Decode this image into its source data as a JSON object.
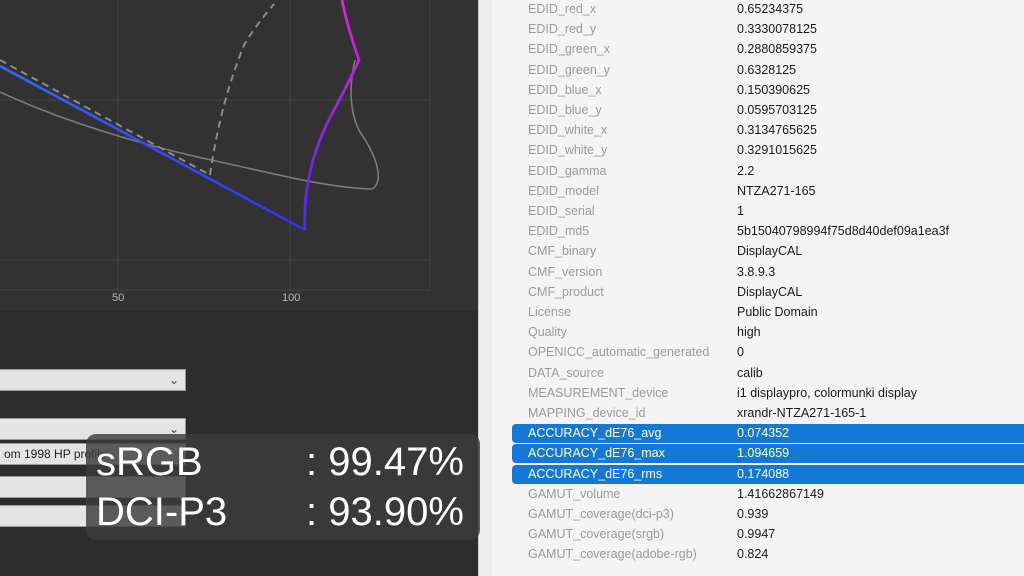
{
  "plot": {
    "x_ticks": [
      "50",
      "100"
    ]
  },
  "controls": {
    "combo_1": "",
    "combo_2": "",
    "combo_3": "om 1998 HP profile"
  },
  "properties": [
    {
      "key": "EDID_red_x",
      "value": "0.65234375",
      "selected": false
    },
    {
      "key": "EDID_red_y",
      "value": "0.3330078125",
      "selected": false
    },
    {
      "key": "EDID_green_x",
      "value": "0.2880859375",
      "selected": false
    },
    {
      "key": "EDID_green_y",
      "value": "0.6328125",
      "selected": false
    },
    {
      "key": "EDID_blue_x",
      "value": "0.150390625",
      "selected": false
    },
    {
      "key": "EDID_blue_y",
      "value": "0.0595703125",
      "selected": false
    },
    {
      "key": "EDID_white_x",
      "value": "0.3134765625",
      "selected": false
    },
    {
      "key": "EDID_white_y",
      "value": "0.3291015625",
      "selected": false
    },
    {
      "key": "EDID_gamma",
      "value": "2.2",
      "selected": false
    },
    {
      "key": "EDID_model",
      "value": "NTZA271-165",
      "selected": false
    },
    {
      "key": "EDID_serial",
      "value": "1",
      "selected": false
    },
    {
      "key": "EDID_md5",
      "value": "5b15040798994f75d8d40def09a1ea3f",
      "selected": false
    },
    {
      "key": "CMF_binary",
      "value": "DisplayCAL",
      "selected": false
    },
    {
      "key": "CMF_version",
      "value": "3.8.9.3",
      "selected": false
    },
    {
      "key": "CMF_product",
      "value": "DisplayCAL",
      "selected": false
    },
    {
      "key": "License",
      "value": "Public Domain",
      "selected": false
    },
    {
      "key": "Quality",
      "value": "high",
      "selected": false
    },
    {
      "key": "OPENICC_automatic_generated",
      "value": "0",
      "selected": false
    },
    {
      "key": "DATA_source",
      "value": "calib",
      "selected": false
    },
    {
      "key": "MEASUREMENT_device",
      "value": "i1 displaypro, colormunki display",
      "selected": false
    },
    {
      "key": "MAPPING_device_id",
      "value": "xrandr-NTZA271-165-1",
      "selected": false
    },
    {
      "key": "ACCURACY_dE76_avg",
      "value": "0.074352",
      "selected": true
    },
    {
      "key": "ACCURACY_dE76_max",
      "value": "1.094659",
      "selected": true
    },
    {
      "key": "ACCURACY_dE76_rms",
      "value": "0.174088",
      "selected": true
    },
    {
      "key": "GAMUT_volume",
      "value": "1.41662867149",
      "selected": false
    },
    {
      "key": "GAMUT_coverage(dci-p3)",
      "value": "0.939",
      "selected": false
    },
    {
      "key": "GAMUT_coverage(srgb)",
      "value": "0.9947",
      "selected": false
    },
    {
      "key": "GAMUT_coverage(adobe-rgb)",
      "value": "0.824",
      "selected": false
    }
  ],
  "overlay": {
    "line1_name": "sRGB",
    "line1_value": ": 99.47%",
    "line2_name": "DCI-P3",
    "line2_value": ": 93.90%"
  },
  "colors": {
    "selection": "#1479d6",
    "gamut_blue": "#2f5cff",
    "gamut_magenta": "#d21fe6"
  }
}
